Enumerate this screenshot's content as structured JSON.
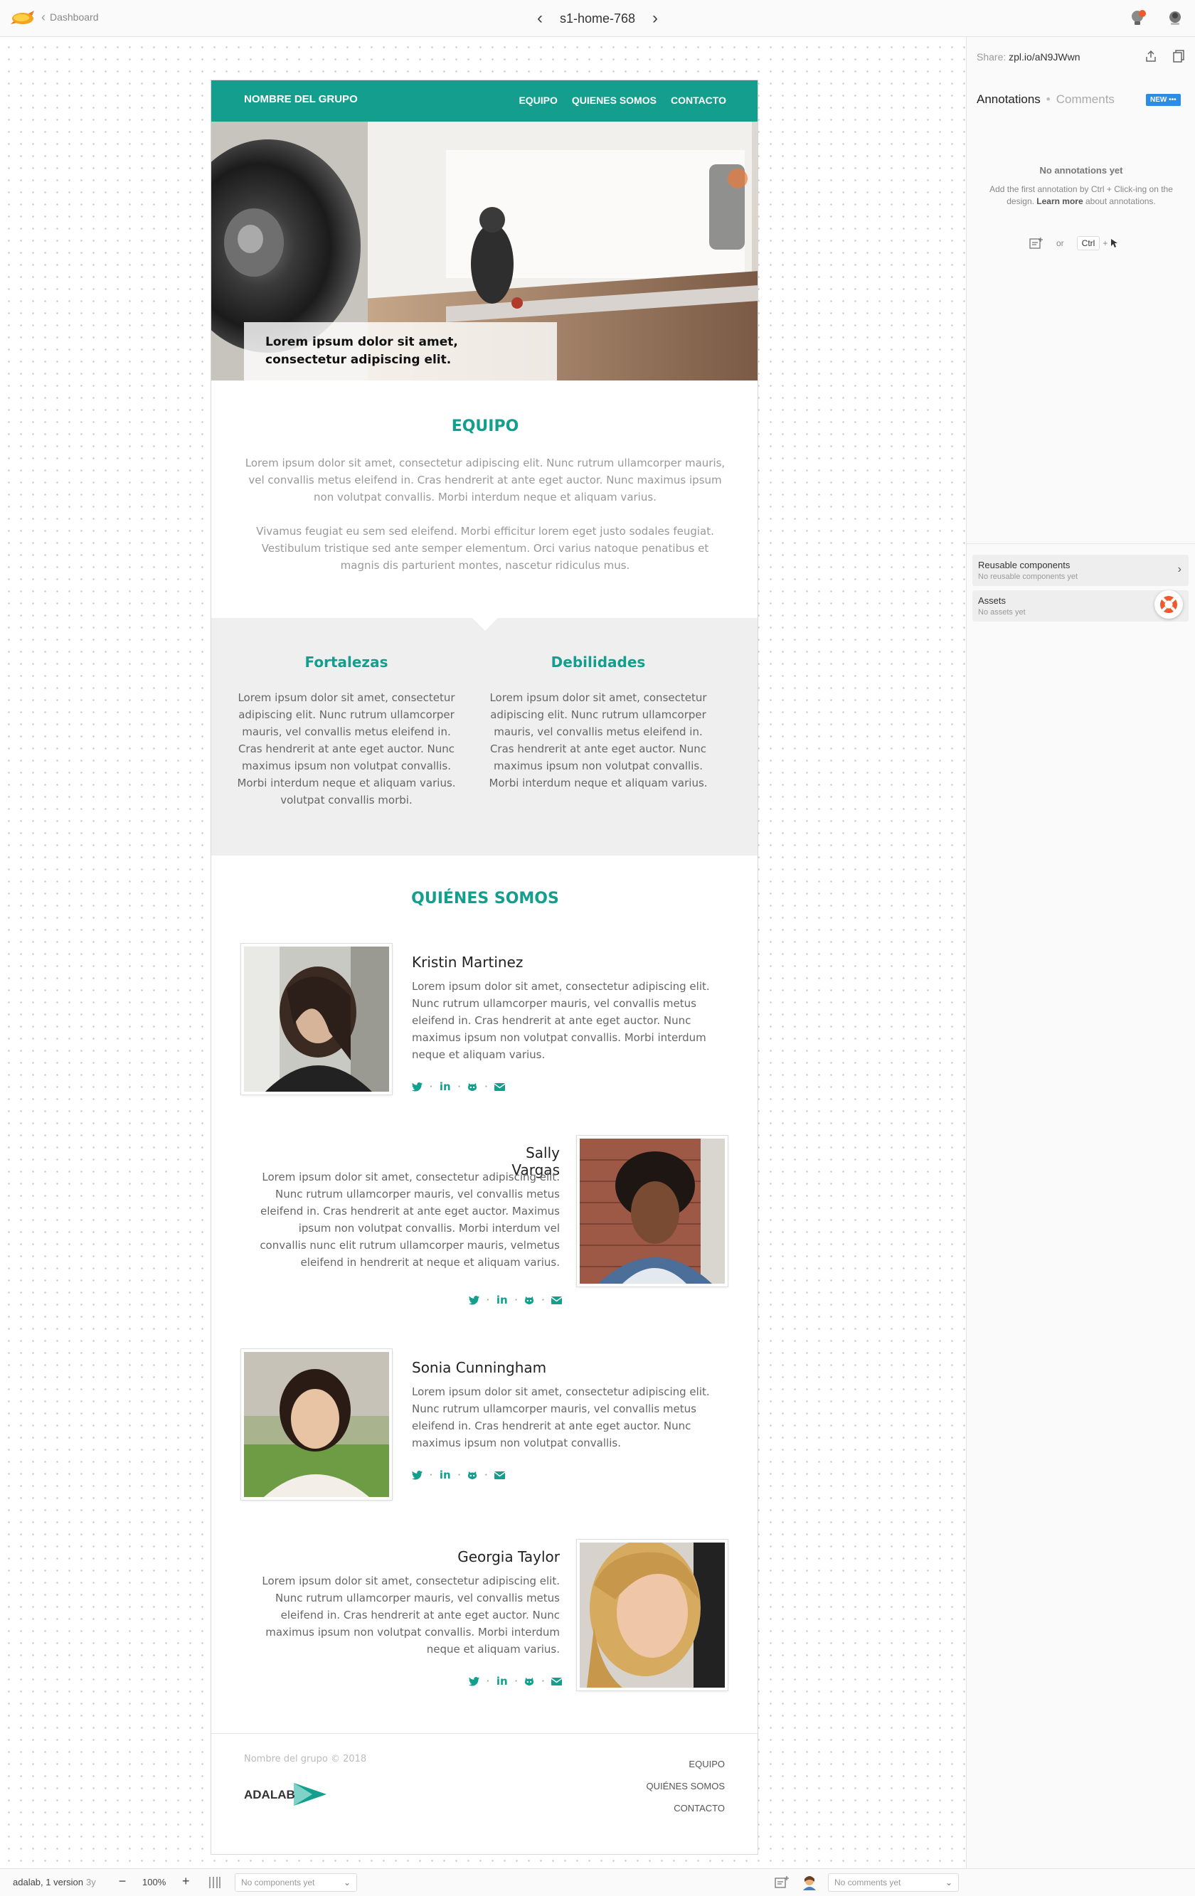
{
  "topbar": {
    "back_label": "Dashboard",
    "screen_name": "s1-home-768"
  },
  "sidebar": {
    "share_label": "Share:",
    "share_url": "zpl.io/aN9JWwn",
    "tab_annotations": "Annotations",
    "tab_separator": "•",
    "tab_comments": "Comments",
    "new_badge": "NEW •••",
    "empty_title": "No annotations yet",
    "empty_desc_1": "Add the first annotation by Ctrl + Click-ing on the design.",
    "empty_learn_more": "Learn more",
    "empty_desc_2": "about annotations.",
    "or_label": "or",
    "kbd_label": "Ctrl",
    "plus_label": "+",
    "reusable_title": "Reusable components",
    "reusable_sub": "No reusable components yet",
    "assets_title": "Assets",
    "assets_sub": "No assets yet"
  },
  "bottombar": {
    "project": "adalab, 1 version",
    "age": "3y",
    "zoom_minus": "−",
    "zoom_value": "100%",
    "zoom_plus": "+",
    "components_placeholder": "No components yet",
    "comments_placeholder": "No comments yet"
  },
  "design": {
    "brand": "NOMBRE DEL GRUPO",
    "nav": [
      "EQUIPO",
      "QUIENES SOMOS",
      "CONTACTO"
    ],
    "hero_caption": "Lorem ipsum dolor sit amet, consectetur adipiscing elit.",
    "team_title": "EQUIPO",
    "team_p1": "Lorem ipsum dolor sit amet, consectetur adipiscing elit. Nunc rutrum ullamcorper mauris, vel convallis metus eleifend in. Cras hendrerit at ante eget auctor. Nunc maximus ipsum non volutpat convallis. Morbi interdum neque et aliquam varius.",
    "team_p2": "Vivamus feugiat eu sem sed eleifend. Morbi efficitur lorem eget justo sodales feugiat. Vestibulum tristique sed ante semper elementum. Orci varius natoque penatibus et magnis dis parturient montes, nascetur ridiculus mus.",
    "strengths_title": "Fortalezas",
    "strengths_text": "Lorem ipsum dolor sit amet, consectetur adipiscing elit. Nunc rutrum ullamcorper mauris, vel convallis metus eleifend in. Cras hendrerit at ante eget auctor. Nunc maximus ipsum non volutpat convallis. Morbi interdum neque et aliquam varius. volutpat convallis morbi.",
    "weak_title": "Debilidades",
    "weak_text": "Lorem ipsum dolor sit amet, consectetur adipiscing elit. Nunc rutrum ullamcorper mauris, vel convallis metus eleifend in. Cras hendrerit at ante eget auctor. Nunc maximus ipsum non volutpat convallis. Morbi interdum neque et aliquam varius.",
    "about_title": "QUIÉNES SOMOS",
    "people": [
      {
        "name": "Kristin Martinez",
        "bio": "Lorem ipsum dolor sit amet, consectetur adipiscing elit. Nunc rutrum ullamcorper mauris, vel convallis metus eleifend in. Cras hendrerit at ante eget auctor. Nunc maximus ipsum non volutpat convallis. Morbi interdum neque et aliquam varius."
      },
      {
        "name": "Sally Vargas",
        "bio": "Lorem ipsum dolor sit amet, consectetur adipiscing elit. Nunc rutrum ullamcorper mauris, vel convallis metus eleifend in. Cras hendrerit at ante eget auctor. Maximus ipsum non volutpat convallis. Morbi interdum  vel convallis nunc elit rutrum ullamcorper mauris, velmetus eleifend in hendrerit at neque et aliquam varius."
      },
      {
        "name": "Sonia Cunningham",
        "bio": "Lorem ipsum dolor sit amet, consectetur adipiscing elit. Nunc rutrum ullamcorper mauris, vel convallis metus eleifend in. Cras hendrerit at ante eget auctor. Nunc maximus ipsum non volutpat convallis."
      },
      {
        "name": "Georgia Taylor",
        "bio": "Lorem ipsum dolor sit amet, consectetur adipiscing elit. Nunc rutrum ullamcorper mauris, vel convallis metus eleifend in. Cras hendrerit at ante eget auctor. Nunc maximus ipsum non volutpat convallis. Morbi interdum neque et aliquam varius."
      }
    ],
    "social": {
      "linkedin": "in",
      "dot": "·"
    },
    "footer_copy": "Nombre del grupo © 2018",
    "footer_links": [
      "EQUIPO",
      "QUIÉNES SOMOS",
      "CONTACTO"
    ],
    "footer_logo": "ADALAB"
  },
  "colors": {
    "accent": "#149e8e",
    "badge": "#2d8ce6",
    "strengths_bg": "#efefef"
  },
  "icons": [
    "zeplin-logo",
    "chevron-left-icon",
    "chevron-right-icon",
    "notification-icon",
    "avatar",
    "upload-icon",
    "copy-icon",
    "annotation-icon",
    "cursor-icon",
    "chevron-right-icon",
    "lifebuoy-icon",
    "grid-icon",
    "twitter-icon",
    "linkedin-icon",
    "github-icon",
    "envelope-icon"
  ]
}
